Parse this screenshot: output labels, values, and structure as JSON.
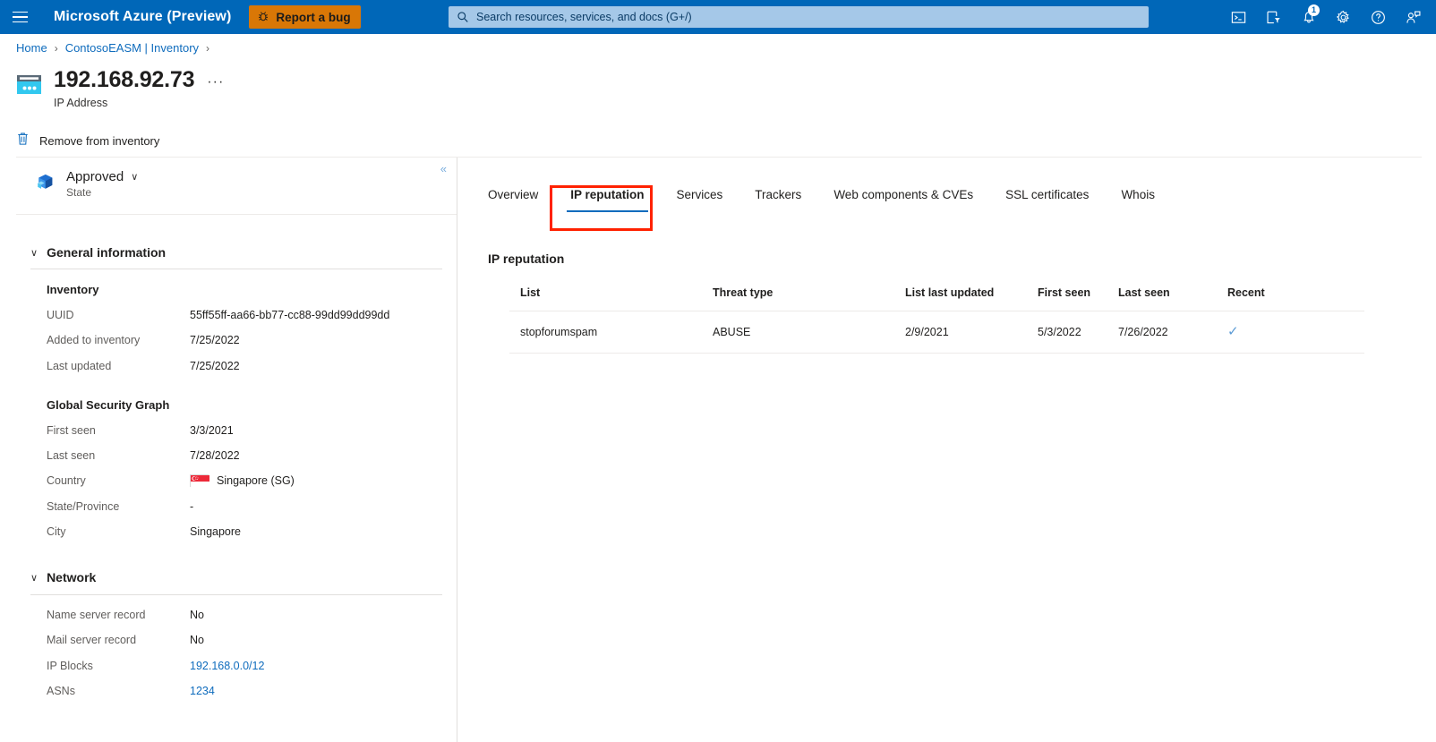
{
  "topbar": {
    "menu_icon": "hamburger-icon",
    "brand": "Microsoft Azure (Preview)",
    "report_bug_label": "Report a bug",
    "report_bug_icon": "bug-icon",
    "report_bug_color": "#d97706",
    "bar_color": "#0067b8",
    "search": {
      "placeholder": "Search resources, services, and docs (G+/)",
      "icon": "search-icon"
    },
    "icons": [
      {
        "name": "cloud-shell-icon",
        "badge": null
      },
      {
        "name": "directory-filter-icon",
        "badge": null
      },
      {
        "name": "notifications-bell-icon",
        "badge": "1"
      },
      {
        "name": "settings-gear-icon",
        "badge": null
      },
      {
        "name": "help-question-icon",
        "badge": null
      },
      {
        "name": "feedback-person-icon",
        "badge": null
      }
    ]
  },
  "breadcrumb": {
    "items": [
      {
        "label": "Home"
      },
      {
        "label": "ContosoEASM | Inventory"
      }
    ],
    "separator": "›"
  },
  "header": {
    "resource_icon": "ip-address-icon",
    "title": "192.168.92.73",
    "subtitle": "IP Address",
    "more_label": "···"
  },
  "command_bar": {
    "items": [
      {
        "label": "Remove from inventory",
        "icon": "trash-icon"
      }
    ]
  },
  "left_panel": {
    "collapse_icon": "collapse-chevrons-icon",
    "state": {
      "icon": "cube-icon",
      "value": "Approved",
      "caret": "∨",
      "label": "State"
    },
    "sections": [
      {
        "title": "General information",
        "caret": "∨",
        "groups": [
          {
            "heading": "Inventory",
            "rows": [
              {
                "key": "UUID",
                "value": "55ff55ff-aa66-bb77-cc88-99dd99dd99dd",
                "link": false
              },
              {
                "key": "Added to inventory",
                "value": "7/25/2022",
                "link": false
              },
              {
                "key": "Last updated",
                "value": "7/25/2022",
                "link": false
              }
            ]
          },
          {
            "heading": "Global Security Graph",
            "rows": [
              {
                "key": "First seen",
                "value": "3/3/2021",
                "link": false
              },
              {
                "key": "Last seen",
                "value": "7/28/2022",
                "link": false
              },
              {
                "key": "Country",
                "value": "Singapore (SG)",
                "link": false,
                "flag": "singapore-flag-icon"
              },
              {
                "key": "State/Province",
                "value": "-",
                "link": false
              },
              {
                "key": "City",
                "value": "Singapore",
                "link": false
              }
            ]
          }
        ]
      },
      {
        "title": "Network",
        "caret": "∨",
        "groups": [
          {
            "heading": "",
            "rows": [
              {
                "key": "Name server record",
                "value": "No",
                "link": false
              },
              {
                "key": "Mail server record",
                "value": "No",
                "link": false
              },
              {
                "key": "IP Blocks",
                "value": "192.168.0.0/12",
                "link": true
              },
              {
                "key": "ASNs",
                "value": "1234",
                "link": true
              }
            ]
          }
        ]
      }
    ]
  },
  "main": {
    "tabs": [
      {
        "label": "Overview",
        "active": false
      },
      {
        "label": "IP reputation",
        "active": true
      },
      {
        "label": "Services",
        "active": false
      },
      {
        "label": "Trackers",
        "active": false
      },
      {
        "label": "Web components & CVEs",
        "active": false
      },
      {
        "label": "SSL certificates",
        "active": false
      },
      {
        "label": "Whois",
        "active": false
      }
    ],
    "content_title": "IP reputation",
    "table": {
      "columns": [
        "List",
        "Threat type",
        "List last updated",
        "First seen",
        "Last seen",
        "Recent"
      ],
      "rows": [
        {
          "list": "stopforumspam",
          "threat_type": "ABUSE",
          "list_last_updated": "2/9/2021",
          "first_seen": "5/3/2022",
          "last_seen": "7/26/2022",
          "recent": "✓"
        }
      ]
    }
  },
  "annotation": {
    "target": "IP reputation",
    "color": "#ff2200"
  },
  "colors": {
    "azure_blue": "#0067b8",
    "link_blue": "#0f6cbd",
    "accent_underline": "#0f6cbd",
    "highlight_red": "#ff2200",
    "report_bug_orange": "#d97706",
    "check_blue": "#5b9bd5"
  }
}
